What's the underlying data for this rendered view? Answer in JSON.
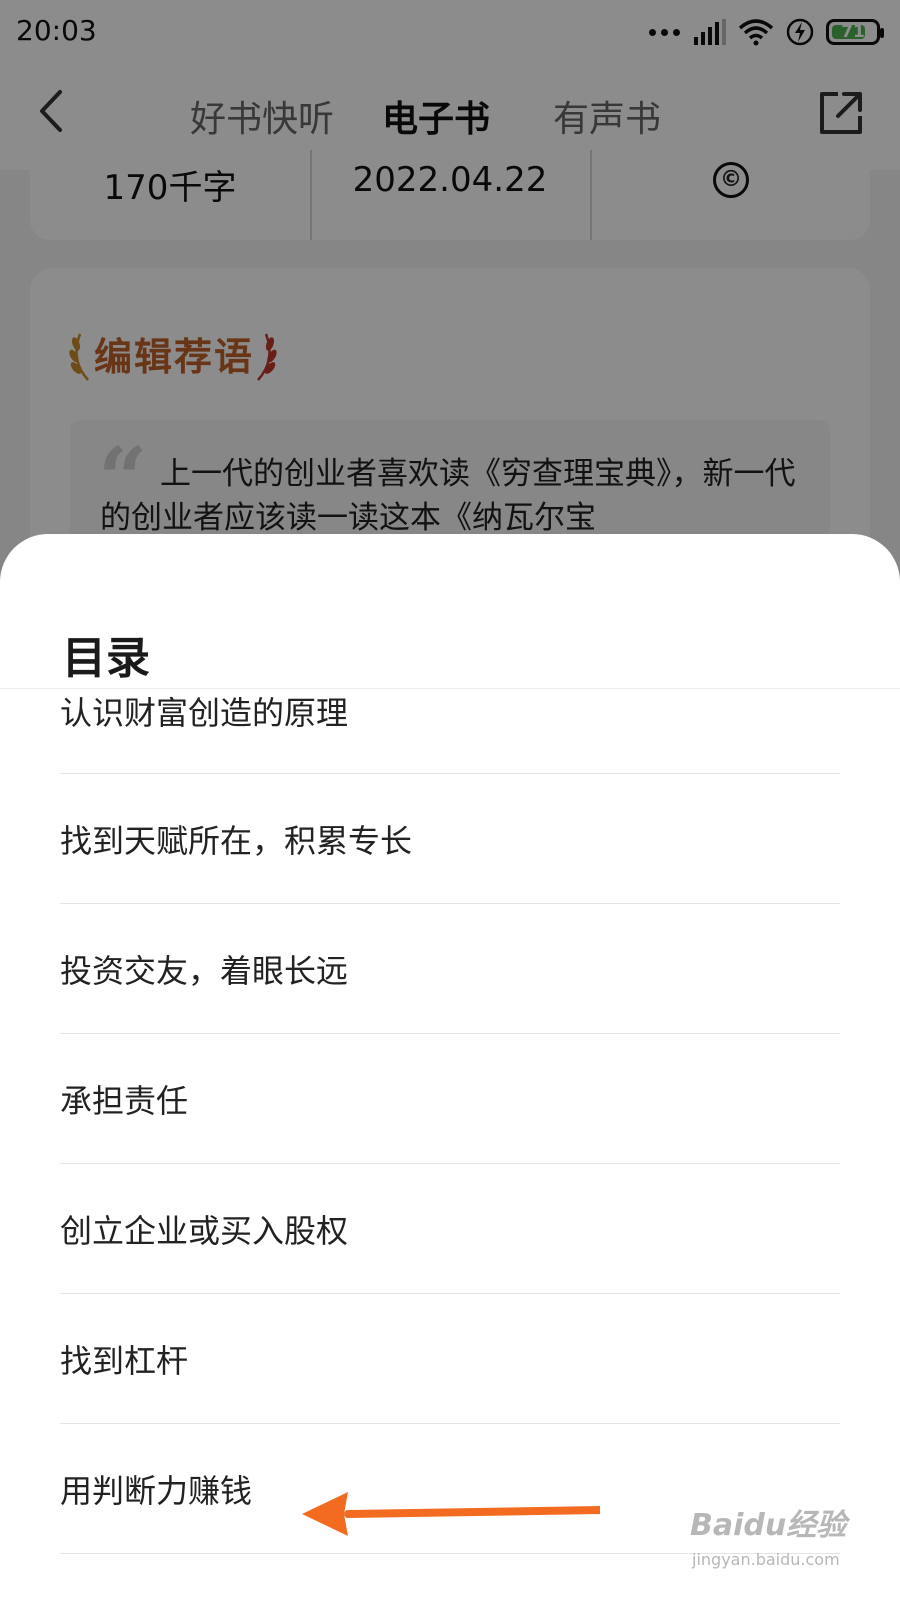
{
  "status_bar": {
    "time": "20:03",
    "battery": "71"
  },
  "nav": {
    "tabs": [
      {
        "label": "好书快听",
        "active": false
      },
      {
        "label": "电子书",
        "active": true
      },
      {
        "label": "有声书",
        "active": false
      }
    ]
  },
  "book_stats": {
    "word_count": "170千字",
    "date": "2022.04.22",
    "copyright_symbol": "©"
  },
  "editor": {
    "title": "编辑荐语",
    "quote": "上一代的创业者喜欢读《穷查理宝典》，新一代的创业者应该读一读这本《纳瓦尔宝"
  },
  "toc": {
    "title": "目录",
    "items": [
      "认识财富创造的原理",
      "找到天赋所在，积累专长",
      "投资交友，着眼长远",
      "承担责任",
      "创立企业或买入股权",
      "找到杠杆",
      "用判断力赚钱"
    ]
  },
  "annotation": {
    "arrow_color": "#f26b21"
  },
  "watermark": {
    "brand": "Baidu经验",
    "url": "jingyan.baidu.com"
  },
  "colors": {
    "accent": "#d9342b",
    "editor_title": "#c0622a"
  }
}
